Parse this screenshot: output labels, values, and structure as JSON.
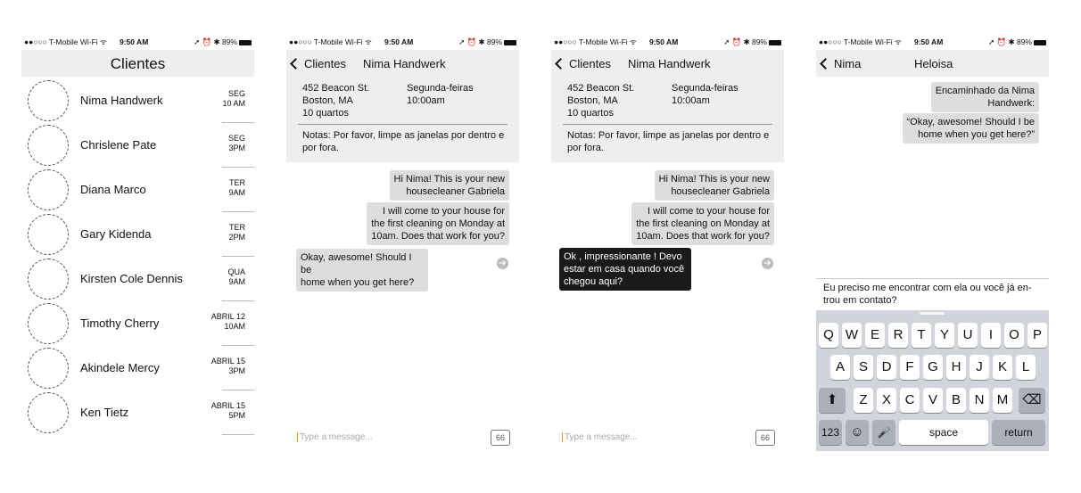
{
  "status": {
    "carrier": "●●○○○ T-Mobile Wi-Fi ᯤ",
    "time": "9:50 AM",
    "right": "➚ ⏰ ✱ 89%"
  },
  "screen1": {
    "title": "Clientes",
    "clients": [
      {
        "name": "Nima Handwerk",
        "when1": "SEG",
        "when2": "10 AM"
      },
      {
        "name": "Chrislene Pate",
        "when1": "SEG",
        "when2": "3PM"
      },
      {
        "name": "Diana Marco",
        "when1": "TER",
        "when2": "9AM"
      },
      {
        "name": "Gary Kidenda",
        "when1": "TER",
        "when2": "2PM"
      },
      {
        "name": "Kirsten Cole Dennis",
        "when1": "QUA",
        "when2": "9AM"
      },
      {
        "name": "Timothy Cherry",
        "when1": "ABRIL 12",
        "when2": "10AM"
      },
      {
        "name": "Akindele Mercy",
        "when1": "ABRIL 15",
        "when2": "3PM"
      },
      {
        "name": "Ken Tietz",
        "when1": "ABRIL 15",
        "when2": "5PM"
      }
    ]
  },
  "detail": {
    "back": "Clientes",
    "title": "Nima Handwerk",
    "addr1": "452 Beacon St.",
    "addr2": "Boston, MA",
    "addr3": "10 quartos",
    "sched1": "Segunda-feiras",
    "sched2": "10:00am",
    "notes": "Notas: Por favor, limpe as janelas por dentro e por fora.",
    "msg1a": "Hi Nima! This is your new",
    "msg1b": "housecleaner Gabriela",
    "msg2a": "I will come to your house for",
    "msg2b": "the first cleaning on Monday at",
    "msg2c": "10am. Does that work for you?",
    "reply_en_a": "Okay, awesome! Should I be",
    "reply_en_b": "home when you get here?",
    "reply_pt_a": "Ok , impressionante ! Devo",
    "reply_pt_b": "estar em casa quando você",
    "reply_pt_c": "chegou aqui?",
    "placeholder": "Type a message...",
    "send_icon": "66"
  },
  "screen4": {
    "back": "Nima",
    "title": "Heloisa",
    "fwd_a": "Encaminhado da Nima",
    "fwd_b": "Handwerk:",
    "quote_a": "“Okay, awesome! Should I be",
    "quote_b": "home when you get here?”",
    "reply_a": "Eu preciso me encontrar com ela ou você já en-",
    "reply_b": "trou em contato?",
    "row1": [
      "Q",
      "W",
      "E",
      "R",
      "T",
      "Y",
      "U",
      "I",
      "O",
      "P"
    ],
    "row2": [
      "A",
      "S",
      "D",
      "F",
      "G",
      "H",
      "J",
      "K",
      "L"
    ],
    "row3": [
      "Z",
      "X",
      "C",
      "V",
      "B",
      "N",
      "M"
    ],
    "shift": "⬆",
    "backspace": "⌫",
    "numbers": "123",
    "emoji": "☺",
    "mic": "🎤",
    "space": "space",
    "return": "return"
  }
}
